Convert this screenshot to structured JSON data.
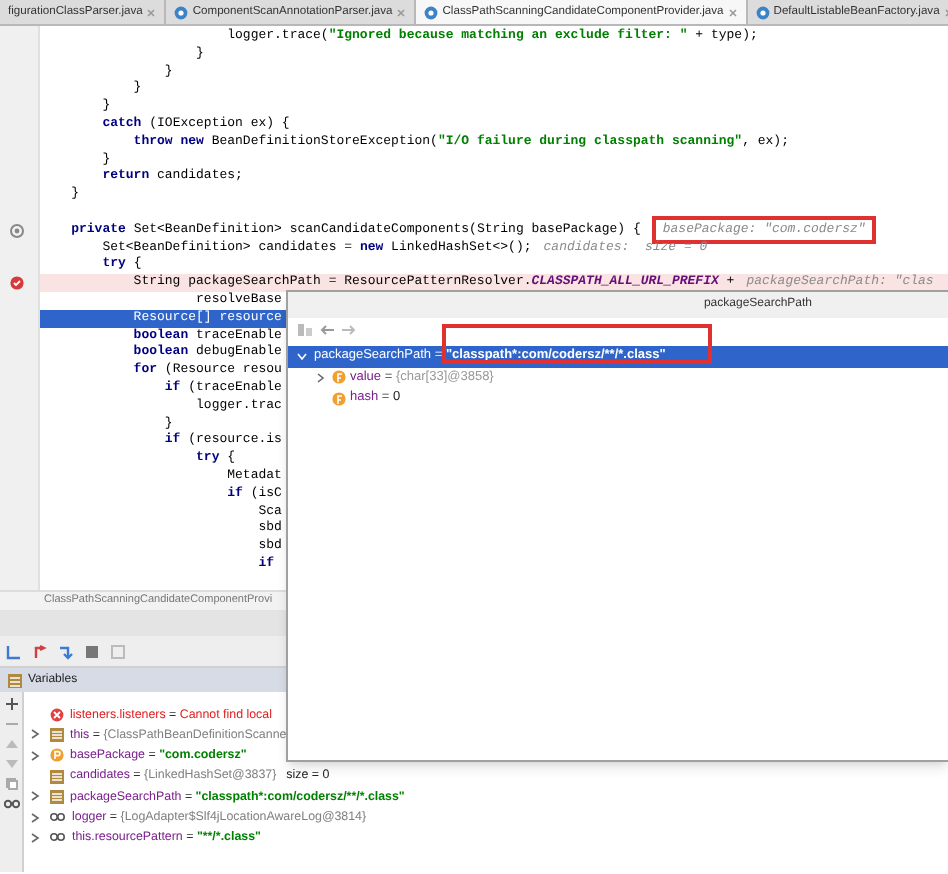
{
  "tabs": [
    {
      "label": "figurationClassParser.java",
      "selected": false
    },
    {
      "label": "ComponentScanAnnotationParser.java",
      "selected": false
    },
    {
      "label": "ClassPathScanningCandidateComponentProvider.java",
      "selected": true
    },
    {
      "label": "DefaultListableBeanFactory.java",
      "selected": false
    }
  ],
  "code_lines": [
    {
      "selected": false,
      "tokens": [
        {
          "kind": "plain",
          "text": "                        logger.trace("
        },
        {
          "kind": "string",
          "text": "\"Ignored because matching an exclude filter: \""
        },
        {
          "kind": "plain",
          "text": " + type);"
        }
      ]
    },
    {
      "selected": false,
      "tokens": [
        {
          "kind": "plain",
          "text": "                    }"
        }
      ]
    },
    {
      "selected": false,
      "tokens": [
        {
          "kind": "plain",
          "text": "                }"
        }
      ]
    },
    {
      "selected": false,
      "tokens": [
        {
          "kind": "plain",
          "text": "            }"
        }
      ]
    },
    {
      "selected": false,
      "tokens": [
        {
          "kind": "plain",
          "text": "        }"
        }
      ]
    },
    {
      "selected": false,
      "tokens": [
        {
          "kind": "keyword",
          "text": "        catch"
        },
        {
          "kind": "plain",
          "text": " (IOException ex) {"
        }
      ]
    },
    {
      "selected": false,
      "tokens": [
        {
          "kind": "keyword",
          "text": "            throw new"
        },
        {
          "kind": "plain",
          "text": " BeanDefinitionStoreException("
        },
        {
          "kind": "string",
          "text": "\"I/O failure during classpath scanning\""
        },
        {
          "kind": "plain",
          "text": ", ex);"
        }
      ]
    },
    {
      "selected": false,
      "tokens": [
        {
          "kind": "plain",
          "text": "        }"
        }
      ]
    },
    {
      "selected": false,
      "tokens": [
        {
          "kind": "keyword",
          "text": "        return"
        },
        {
          "kind": "plain",
          "text": " candidates;"
        }
      ]
    },
    {
      "selected": false,
      "tokens": [
        {
          "kind": "plain",
          "text": "    }"
        }
      ]
    },
    {
      "selected": false
    },
    {
      "selected": false,
      "gutter": {
        "kind": "method"
      },
      "tokens": [
        {
          "kind": "keyword",
          "text": "    private"
        },
        {
          "kind": "plain",
          "text": " Set<BeanDefinition> scanCandidateComponents(String basePackage) {"
        }
      ],
      "hint": {
        "text": "basePackage: \"com.codersz\"",
        "boxed": true
      }
    },
    {
      "selected": false,
      "tokens": [
        {
          "kind": "plain",
          "text": "        Set<BeanDefinition> candidates = "
        },
        {
          "kind": "keyword",
          "text": "new"
        },
        {
          "kind": "plain",
          "text": " LinkedHashSet<>();"
        }
      ],
      "hint": {
        "text": "candidates:  size = 0",
        "boxed": false
      }
    },
    {
      "selected": false,
      "tokens": [
        {
          "kind": "keyword",
          "text": "        try"
        },
        {
          "kind": "plain",
          "text": " {"
        }
      ]
    },
    {
      "selected": false,
      "gutter": {
        "kind": "breakpoint"
      },
      "tokens": [
        {
          "kind": "plain",
          "text": "            String packageSearchPath = ResourcePatternResolver."
        },
        {
          "kind": "constant",
          "text": "CLASSPATH_ALL_URL_PREFIX"
        },
        {
          "kind": "plain",
          "text": " +"
        }
      ],
      "hint": {
        "text": "packageSearchPath: \"clas",
        "boxed": false
      }
    },
    {
      "selected": false,
      "tokens": [
        {
          "kind": "plain",
          "text": "                    resolveBase"
        }
      ]
    },
    {
      "selected": true,
      "tokens": [
        {
          "kind": "plain",
          "text": "            Resource[] resource"
        }
      ]
    },
    {
      "selected": false,
      "tokens": [
        {
          "kind": "keyword",
          "text": "            boolean"
        },
        {
          "kind": "plain",
          "text": " traceEnable"
        }
      ]
    },
    {
      "selected": false,
      "tokens": [
        {
          "kind": "keyword",
          "text": "            boolean"
        },
        {
          "kind": "plain",
          "text": " debugEnable"
        }
      ]
    },
    {
      "selected": false,
      "tokens": [
        {
          "kind": "keyword",
          "text": "            for"
        },
        {
          "kind": "plain",
          "text": " (Resource resou"
        }
      ]
    },
    {
      "selected": false,
      "tokens": [
        {
          "kind": "keyword",
          "text": "                if"
        },
        {
          "kind": "plain",
          "text": " (traceEnable"
        }
      ]
    },
    {
      "selected": false,
      "tokens": [
        {
          "kind": "plain",
          "text": "                    logger.trac"
        }
      ]
    },
    {
      "selected": false,
      "tokens": [
        {
          "kind": "plain",
          "text": "                }"
        }
      ]
    },
    {
      "selected": false,
      "tokens": [
        {
          "kind": "keyword",
          "text": "                if"
        },
        {
          "kind": "plain",
          "text": " (resource.is"
        }
      ]
    },
    {
      "selected": false,
      "tokens": [
        {
          "kind": "keyword",
          "text": "                    try"
        },
        {
          "kind": "plain",
          "text": " {"
        }
      ]
    },
    {
      "selected": false,
      "tokens": [
        {
          "kind": "plain",
          "text": "                        Metadat"
        }
      ]
    },
    {
      "selected": false,
      "tokens": [
        {
          "kind": "keyword",
          "text": "                        if"
        },
        {
          "kind": "plain",
          "text": " (isC"
        }
      ]
    },
    {
      "selected": false,
      "tokens": [
        {
          "kind": "plain",
          "text": "                            Sca"
        }
      ]
    },
    {
      "selected": false,
      "tokens": [
        {
          "kind": "plain",
          "text": "                            sbd"
        }
      ]
    },
    {
      "selected": false,
      "tokens": [
        {
          "kind": "plain",
          "text": "                            sbd"
        }
      ]
    },
    {
      "selected": false,
      "tokens": [
        {
          "kind": "keyword",
          "text": "                            if"
        }
      ]
    }
  ],
  "breadcrumb": "ClassPathScanningCandidateComponentProvi",
  "variables": {
    "title": "Variables",
    "rows": [
      {
        "kind": "error",
        "expandable": false,
        "name": "listeners.listeners",
        "sep": "=",
        "value": {
          "kind": "error",
          "text": "Cannot find local"
        }
      },
      {
        "kind": "object",
        "expandable": true,
        "name": "this",
        "sep": "=",
        "value": {
          "kind": "object",
          "text": "{ClassPathBeanDefinitionScanne"
        }
      },
      {
        "kind": "param",
        "expandable": true,
        "name": "basePackage",
        "sep": "=",
        "value": {
          "kind": "string",
          "text": "\"com.codersz\""
        }
      },
      {
        "kind": "object",
        "expandable": false,
        "name": "candidates",
        "sep": "=",
        "value": {
          "kind": "object",
          "text": "{LinkedHashSet@3837}"
        },
        "extra": "size = 0"
      },
      {
        "kind": "object",
        "expandable": true,
        "name": "packageSearchPath",
        "sep": "=",
        "value": {
          "kind": "string",
          "text": "\"classpath*:com/codersz/**/*.class\""
        }
      },
      {
        "kind": "watch",
        "expandable": true,
        "name": "logger",
        "sep": "=",
        "value": {
          "kind": "object",
          "text": "{LogAdapter$Slf4jLocationAwareLog@3814}"
        }
      },
      {
        "kind": "watch",
        "expandable": true,
        "name": "this.resourcePattern",
        "sep": "=",
        "value": {
          "kind": "string",
          "text": "\"**/*.class\""
        }
      }
    ]
  },
  "popup": {
    "title": "packageSearchPath",
    "rows": [
      {
        "name": "packageSearchPath",
        "sep": "=",
        "value": "\"classpath*:com/codersz/**/*.class\"",
        "selected": true,
        "expanded": true,
        "children": [
          {
            "name": "value",
            "sep": "=",
            "value": "{char[33]@3858}",
            "selected": false,
            "expanded": false,
            "expandable": true
          },
          {
            "name": "hash",
            "sep": "=",
            "value": "0",
            "selected": false,
            "expanded": false,
            "expandable": false
          }
        ]
      }
    ]
  }
}
